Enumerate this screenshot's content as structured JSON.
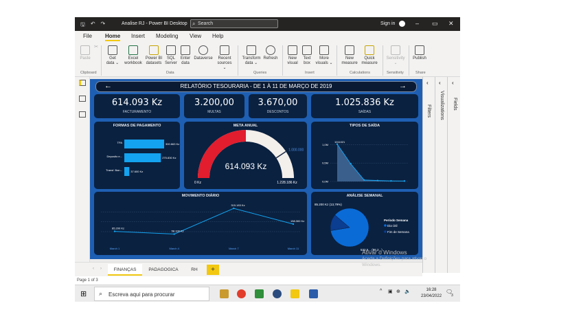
{
  "titlebar": {
    "title": "Analise RJ - Power BI Desktop",
    "search_label": "Search",
    "signin_label": "Sign in",
    "minimize": "–",
    "restore": "▭",
    "close": "✕"
  },
  "menu": [
    "File",
    "Home",
    "Insert",
    "Modeling",
    "View",
    "Help"
  ],
  "ribbon": {
    "paste": "Paste",
    "get_data": "Get data ⌄",
    "excel": "Excel workbook",
    "pbi_datasets": "Power BI datasets",
    "sql": "SQL Server",
    "enter_data": "Enter data",
    "dataverse": "Dataverse",
    "recent": "Recent sources ⌄",
    "transform": "Transform data ⌄",
    "refresh": "Refresh",
    "new_visual": "New visual",
    "text_box": "Text box",
    "more_visuals": "More visuals ⌄",
    "new_measure": "New measure",
    "quick_measure": "Quick measure",
    "sensitivity": "Sensitivity ⌄",
    "publish": "Publish",
    "groups": [
      "Clipboard",
      "Data",
      "Queries",
      "Insert",
      "Calculations",
      "Sensitivity",
      "Share"
    ]
  },
  "report": {
    "title": "RELATÓRIO TESOURARIA - DE 1 À 11 DE MARÇO DE 2019",
    "kpis": [
      {
        "value": "614.093 Kz",
        "label": "FACTURAMENTO"
      },
      {
        "value": "3.200,00",
        "label": "MULTAS"
      },
      {
        "value": "3.670,00",
        "label": "DESCONTOS"
      },
      {
        "value": "1.025.836 Kz",
        "label": "SAÍDAS"
      }
    ],
    "formas": {
      "title": "FORMAS DE PAGAMENTO",
      "rows": [
        {
          "label": "TPA",
          "value": 300.663,
          "text": "300.663 Kz"
        },
        {
          "label": "Deposito e...",
          "value": 275.83,
          "text": "275.830 Kz"
        },
        {
          "label": "Transf. Ban...",
          "value": 37.6,
          "text": "37.600 Kz"
        }
      ],
      "max": 300.663
    },
    "meta": {
      "title": "META ANUAL",
      "value_label": "614.093 Kz",
      "value": 614093,
      "min": 0,
      "max": 1228186,
      "target": 1000000,
      "min_label": "0 Kz",
      "max_label": "1.228.186 Kz",
      "target_label": "1.000.000"
    },
    "tipos": {
      "title": "TIPOS DE SAÍDA",
      "y_ticks": [
        "1,0M",
        "0,5M",
        "0,0M"
      ],
      "peak_label": "1011021",
      "values": [
        1011021,
        480000,
        40000,
        25000,
        15000,
        12000
      ]
    },
    "movimento": {
      "title": "MOVIMENTO DIÁRIO",
      "categories": [
        "March 1",
        "March 4",
        "March 7",
        "March 11"
      ],
      "values": [
        85200,
        58100,
        315183,
        158300
      ],
      "labels": [
        "85.200 Kz",
        "58.100 Kz",
        "315.183 Kz",
        "158.300 Kz"
      ]
    },
    "semanal": {
      "title": "ANÁLISE SEMANAL",
      "top_label": "85.200 Kz (13,79%)",
      "bottom_label": "532.5... (86,2...)",
      "legend_title": "Período Semana",
      "legend": [
        {
          "name": "Dia Útil",
          "color": "#0a6bd6"
        },
        {
          "name": "Fim de Semana",
          "color": "#0b3d91"
        }
      ],
      "slices": [
        86.21,
        13.79
      ]
    }
  },
  "panes": {
    "filters": "Filters",
    "visualizations": "Visualizations",
    "fields": "Fields"
  },
  "tabs": [
    "FINANÇAS",
    "PADAGOGICA",
    "RH"
  ],
  "tab_add": "+",
  "status": "Page 1 of 3",
  "watermark": {
    "line1": "Ativar o Windows",
    "line2": "Aceda a Definições para ativar o",
    "line3": "Windows."
  },
  "taskbar": {
    "search_placeholder": "Escreva aqui para procurar",
    "time": "16:28",
    "date": "23/04/2022",
    "notif": "3"
  },
  "colors": {
    "accent": "#f2c811",
    "report_bg": "#1e5fb3",
    "card": "#0a2140",
    "gauge_fill": "#e11d2e",
    "bar": "#14a3f0"
  }
}
